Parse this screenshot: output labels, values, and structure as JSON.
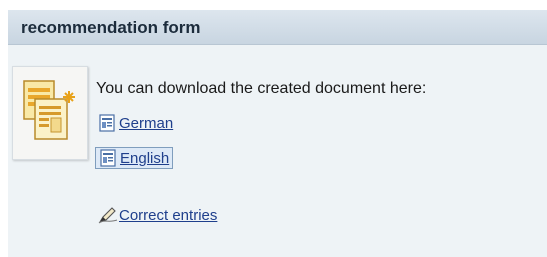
{
  "header": {
    "title": "recommendation form"
  },
  "main": {
    "message": "You can download the created document here:",
    "links": {
      "german": "German",
      "english": "English",
      "correct": "Correct entries"
    }
  },
  "icons": {
    "document": "new-document-icon",
    "file": "document-file-icon",
    "edit": "pencil-edit-icon"
  }
}
